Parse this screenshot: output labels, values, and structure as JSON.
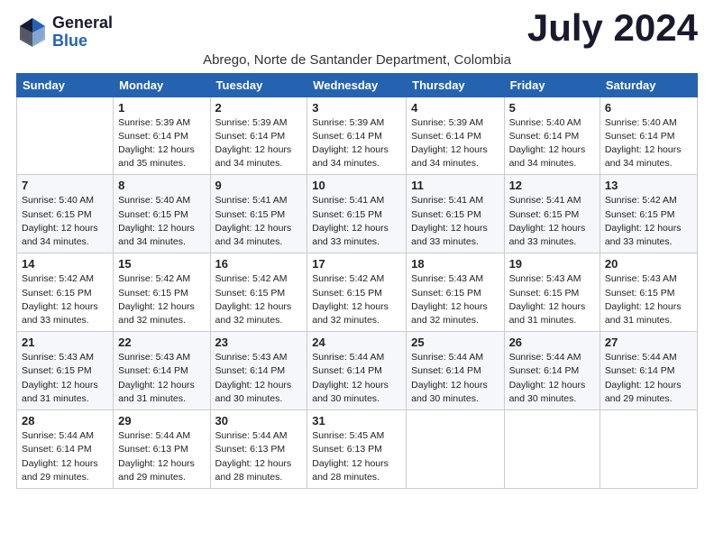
{
  "header": {
    "logo_general": "General",
    "logo_blue": "Blue",
    "month_title": "July 2024",
    "subtitle": "Abrego, Norte de Santander Department, Colombia"
  },
  "days_of_week": [
    "Sunday",
    "Monday",
    "Tuesday",
    "Wednesday",
    "Thursday",
    "Friday",
    "Saturday"
  ],
  "weeks": [
    [
      {
        "day": "",
        "sunrise": "",
        "sunset": "",
        "daylight": ""
      },
      {
        "day": "1",
        "sunrise": "Sunrise: 5:39 AM",
        "sunset": "Sunset: 6:14 PM",
        "daylight": "Daylight: 12 hours and 35 minutes."
      },
      {
        "day": "2",
        "sunrise": "Sunrise: 5:39 AM",
        "sunset": "Sunset: 6:14 PM",
        "daylight": "Daylight: 12 hours and 34 minutes."
      },
      {
        "day": "3",
        "sunrise": "Sunrise: 5:39 AM",
        "sunset": "Sunset: 6:14 PM",
        "daylight": "Daylight: 12 hours and 34 minutes."
      },
      {
        "day": "4",
        "sunrise": "Sunrise: 5:39 AM",
        "sunset": "Sunset: 6:14 PM",
        "daylight": "Daylight: 12 hours and 34 minutes."
      },
      {
        "day": "5",
        "sunrise": "Sunrise: 5:40 AM",
        "sunset": "Sunset: 6:14 PM",
        "daylight": "Daylight: 12 hours and 34 minutes."
      },
      {
        "day": "6",
        "sunrise": "Sunrise: 5:40 AM",
        "sunset": "Sunset: 6:14 PM",
        "daylight": "Daylight: 12 hours and 34 minutes."
      }
    ],
    [
      {
        "day": "7",
        "sunrise": "Sunrise: 5:40 AM",
        "sunset": "Sunset: 6:15 PM",
        "daylight": "Daylight: 12 hours and 34 minutes."
      },
      {
        "day": "8",
        "sunrise": "Sunrise: 5:40 AM",
        "sunset": "Sunset: 6:15 PM",
        "daylight": "Daylight: 12 hours and 34 minutes."
      },
      {
        "day": "9",
        "sunrise": "Sunrise: 5:41 AM",
        "sunset": "Sunset: 6:15 PM",
        "daylight": "Daylight: 12 hours and 34 minutes."
      },
      {
        "day": "10",
        "sunrise": "Sunrise: 5:41 AM",
        "sunset": "Sunset: 6:15 PM",
        "daylight": "Daylight: 12 hours and 33 minutes."
      },
      {
        "day": "11",
        "sunrise": "Sunrise: 5:41 AM",
        "sunset": "Sunset: 6:15 PM",
        "daylight": "Daylight: 12 hours and 33 minutes."
      },
      {
        "day": "12",
        "sunrise": "Sunrise: 5:41 AM",
        "sunset": "Sunset: 6:15 PM",
        "daylight": "Daylight: 12 hours and 33 minutes."
      },
      {
        "day": "13",
        "sunrise": "Sunrise: 5:42 AM",
        "sunset": "Sunset: 6:15 PM",
        "daylight": "Daylight: 12 hours and 33 minutes."
      }
    ],
    [
      {
        "day": "14",
        "sunrise": "Sunrise: 5:42 AM",
        "sunset": "Sunset: 6:15 PM",
        "daylight": "Daylight: 12 hours and 33 minutes."
      },
      {
        "day": "15",
        "sunrise": "Sunrise: 5:42 AM",
        "sunset": "Sunset: 6:15 PM",
        "daylight": "Daylight: 12 hours and 32 minutes."
      },
      {
        "day": "16",
        "sunrise": "Sunrise: 5:42 AM",
        "sunset": "Sunset: 6:15 PM",
        "daylight": "Daylight: 12 hours and 32 minutes."
      },
      {
        "day": "17",
        "sunrise": "Sunrise: 5:42 AM",
        "sunset": "Sunset: 6:15 PM",
        "daylight": "Daylight: 12 hours and 32 minutes."
      },
      {
        "day": "18",
        "sunrise": "Sunrise: 5:43 AM",
        "sunset": "Sunset: 6:15 PM",
        "daylight": "Daylight: 12 hours and 32 minutes."
      },
      {
        "day": "19",
        "sunrise": "Sunrise: 5:43 AM",
        "sunset": "Sunset: 6:15 PM",
        "daylight": "Daylight: 12 hours and 31 minutes."
      },
      {
        "day": "20",
        "sunrise": "Sunrise: 5:43 AM",
        "sunset": "Sunset: 6:15 PM",
        "daylight": "Daylight: 12 hours and 31 minutes."
      }
    ],
    [
      {
        "day": "21",
        "sunrise": "Sunrise: 5:43 AM",
        "sunset": "Sunset: 6:15 PM",
        "daylight": "Daylight: 12 hours and 31 minutes."
      },
      {
        "day": "22",
        "sunrise": "Sunrise: 5:43 AM",
        "sunset": "Sunset: 6:14 PM",
        "daylight": "Daylight: 12 hours and 31 minutes."
      },
      {
        "day": "23",
        "sunrise": "Sunrise: 5:43 AM",
        "sunset": "Sunset: 6:14 PM",
        "daylight": "Daylight: 12 hours and 30 minutes."
      },
      {
        "day": "24",
        "sunrise": "Sunrise: 5:44 AM",
        "sunset": "Sunset: 6:14 PM",
        "daylight": "Daylight: 12 hours and 30 minutes."
      },
      {
        "day": "25",
        "sunrise": "Sunrise: 5:44 AM",
        "sunset": "Sunset: 6:14 PM",
        "daylight": "Daylight: 12 hours and 30 minutes."
      },
      {
        "day": "26",
        "sunrise": "Sunrise: 5:44 AM",
        "sunset": "Sunset: 6:14 PM",
        "daylight": "Daylight: 12 hours and 30 minutes."
      },
      {
        "day": "27",
        "sunrise": "Sunrise: 5:44 AM",
        "sunset": "Sunset: 6:14 PM",
        "daylight": "Daylight: 12 hours and 29 minutes."
      }
    ],
    [
      {
        "day": "28",
        "sunrise": "Sunrise: 5:44 AM",
        "sunset": "Sunset: 6:14 PM",
        "daylight": "Daylight: 12 hours and 29 minutes."
      },
      {
        "day": "29",
        "sunrise": "Sunrise: 5:44 AM",
        "sunset": "Sunset: 6:13 PM",
        "daylight": "Daylight: 12 hours and 29 minutes."
      },
      {
        "day": "30",
        "sunrise": "Sunrise: 5:44 AM",
        "sunset": "Sunset: 6:13 PM",
        "daylight": "Daylight: 12 hours and 28 minutes."
      },
      {
        "day": "31",
        "sunrise": "Sunrise: 5:45 AM",
        "sunset": "Sunset: 6:13 PM",
        "daylight": "Daylight: 12 hours and 28 minutes."
      },
      {
        "day": "",
        "sunrise": "",
        "sunset": "",
        "daylight": ""
      },
      {
        "day": "",
        "sunrise": "",
        "sunset": "",
        "daylight": ""
      },
      {
        "day": "",
        "sunrise": "",
        "sunset": "",
        "daylight": ""
      }
    ]
  ]
}
